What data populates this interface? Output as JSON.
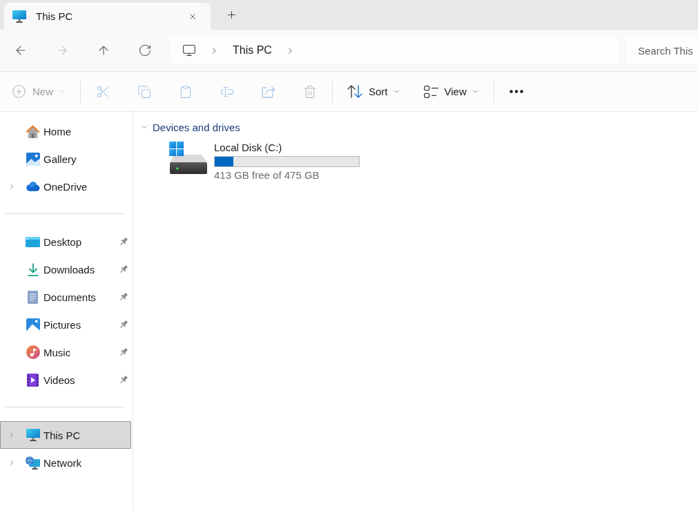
{
  "tabs": [
    {
      "title": "This PC",
      "selected": true
    }
  ],
  "navigation": [
    {
      "kind": "back",
      "disabled": false
    },
    {
      "kind": "forward",
      "disabled": true
    },
    {
      "kind": "up",
      "disabled": false
    },
    {
      "kind": "refresh",
      "disabled": false
    }
  ],
  "address_bar": {
    "path": [
      "This PC"
    ]
  },
  "search": {
    "placeholder": "Search This"
  },
  "toolbar": {
    "groups": [
      {
        "items": [
          {
            "kind": "new",
            "label": "New",
            "disabled": true
          }
        ]
      },
      {
        "items": [
          {
            "kind": "cut",
            "disabled": true
          },
          {
            "kind": "copy",
            "disabled": true
          },
          {
            "kind": "paste",
            "disabled": true
          },
          {
            "kind": "rename",
            "disabled": true
          },
          {
            "kind": "share",
            "disabled": true
          },
          {
            "kind": "delete",
            "disabled": true
          }
        ]
      },
      {
        "items": [
          {
            "kind": "sort",
            "label": "Sort",
            "disabled": false
          },
          {
            "kind": "view",
            "label": "View",
            "disabled": false
          }
        ]
      },
      {
        "items": [
          {
            "kind": "more",
            "disabled": false
          }
        ]
      }
    ]
  },
  "sidebar": {
    "sections": [
      {
        "items": [
          {
            "kind": "home",
            "label": "Home",
            "expandable": false,
            "expanded": false,
            "pinned": false,
            "selected": false
          },
          {
            "kind": "gallery",
            "label": "Gallery",
            "expandable": false,
            "expanded": false,
            "pinned": false,
            "selected": false
          },
          {
            "kind": "onedrive",
            "label": "OneDrive",
            "expandable": true,
            "expanded": false,
            "pinned": false,
            "selected": false
          }
        ]
      },
      {
        "items": [
          {
            "kind": "desktop",
            "label": "Desktop",
            "expandable": false,
            "expanded": false,
            "pinned": true,
            "selected": false
          },
          {
            "kind": "downloads",
            "label": "Downloads",
            "expandable": false,
            "expanded": false,
            "pinned": true,
            "selected": false
          },
          {
            "kind": "documents",
            "label": "Documents",
            "expandable": false,
            "expanded": false,
            "pinned": true,
            "selected": false
          },
          {
            "kind": "pictures",
            "label": "Pictures",
            "expandable": false,
            "expanded": false,
            "pinned": true,
            "selected": false
          },
          {
            "kind": "music",
            "label": "Music",
            "expandable": false,
            "expanded": false,
            "pinned": true,
            "selected": false
          },
          {
            "kind": "videos",
            "label": "Videos",
            "expandable": false,
            "expanded": false,
            "pinned": true,
            "selected": false
          }
        ]
      },
      {
        "items": [
          {
            "kind": "this_pc",
            "label": "This PC",
            "expandable": true,
            "expanded": false,
            "pinned": false,
            "selected": true
          },
          {
            "kind": "network",
            "label": "Network",
            "expandable": true,
            "expanded": false,
            "pinned": false,
            "selected": false
          }
        ]
      }
    ]
  },
  "content": {
    "groups": [
      {
        "title": "Devices and drives",
        "expanded": true,
        "drives": [
          {
            "name": "Local Disk (C:)",
            "level": 0.13,
            "free_space": "413 GB free of 475 GB"
          }
        ]
      }
    ]
  }
}
